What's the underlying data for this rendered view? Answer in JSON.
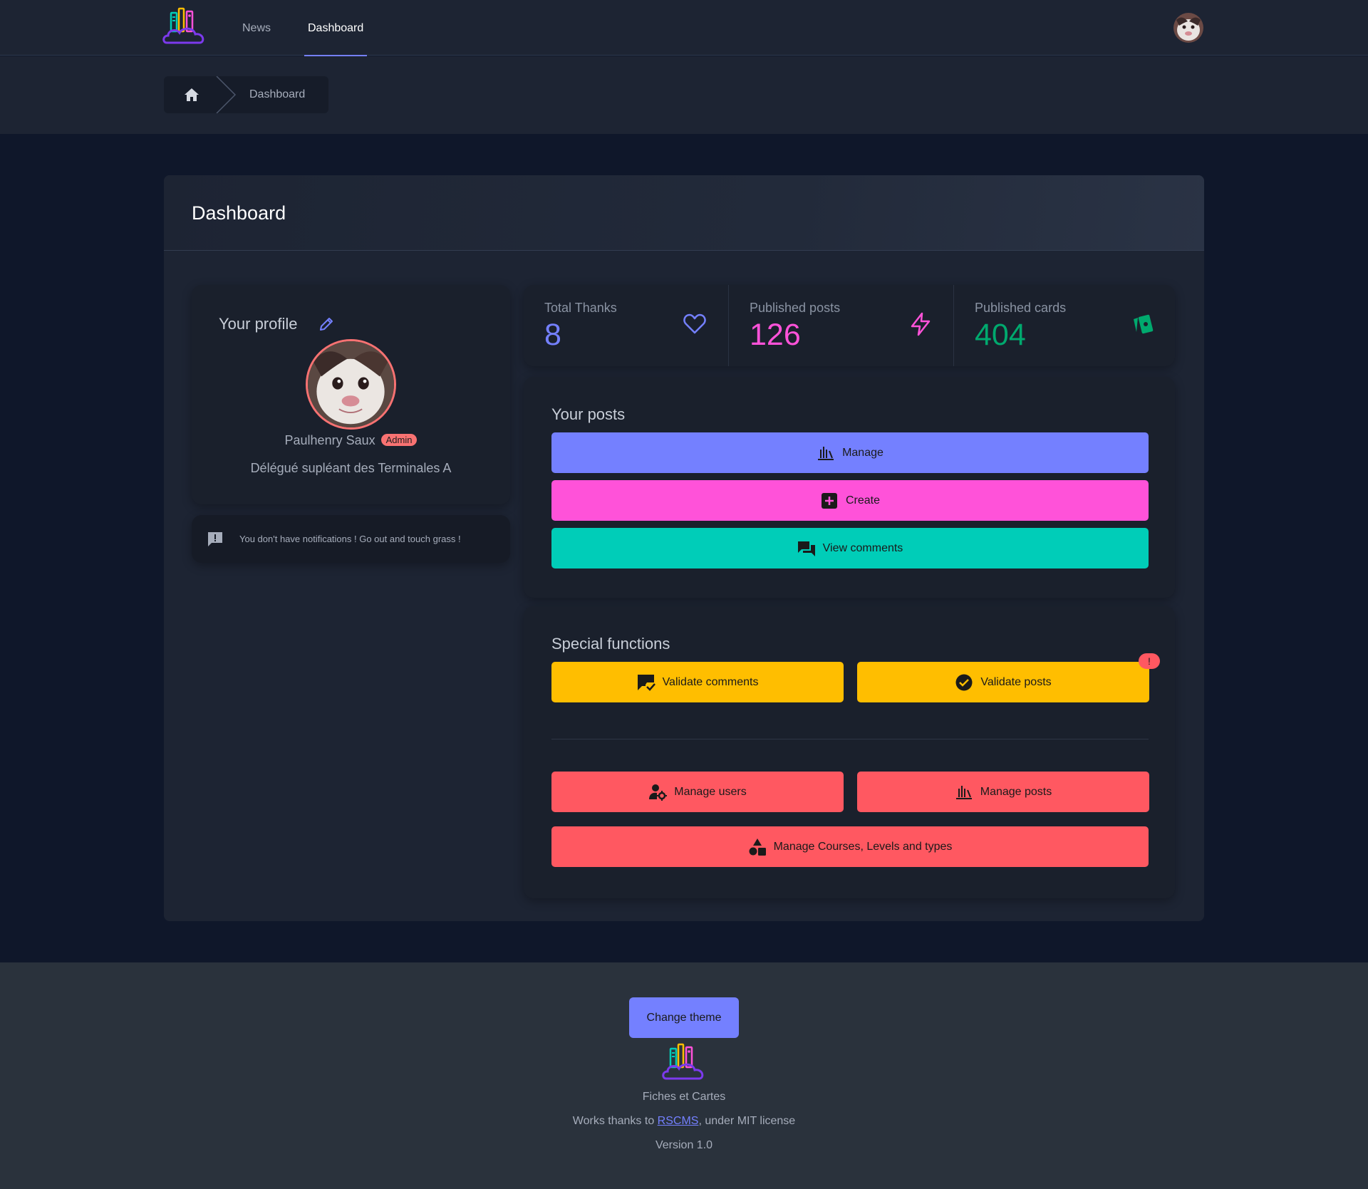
{
  "nav": {
    "links": [
      {
        "label": "News",
        "active": false
      },
      {
        "label": "Dashboard",
        "active": true
      }
    ],
    "logo_icon": "books-cloud-logo",
    "avatar_icon": "cat-avatar"
  },
  "breadcrumb": {
    "home_icon": "home-icon",
    "current": "Dashboard"
  },
  "page": {
    "title": "Dashboard"
  },
  "profile": {
    "heading": "Your profile",
    "edit_icon": "pencil-icon",
    "name": "Paulhenry Saux",
    "badge": "Admin",
    "role": "Délégué supléant des Terminales A"
  },
  "notification": {
    "icon": "announcement-icon",
    "text": "You don't have notifications ! Go out and touch grass !"
  },
  "stats": [
    {
      "title": "Total Thanks",
      "value": "8",
      "icon": "heart-icon",
      "color": "#7480ff"
    },
    {
      "title": "Published posts",
      "value": "126",
      "icon": "lightning-icon",
      "color": "#ff52d9"
    },
    {
      "title": "Published cards",
      "value": "404",
      "icon": "cards-icon",
      "color": "#00a96e"
    }
  ],
  "posts": {
    "title": "Your posts",
    "buttons": {
      "manage": "Manage",
      "create": "Create",
      "view_comments": "View comments"
    }
  },
  "special": {
    "title": "Special functions",
    "validate_comments": "Validate comments",
    "validate_posts": "Validate posts",
    "validate_posts_indicator": "!",
    "manage_users": "Manage users",
    "manage_posts": "Manage posts",
    "manage_courses": "Manage Courses, Levels and types"
  },
  "footer": {
    "theme_button": "Change theme",
    "site_name": "Fiches et Cartes",
    "credits_prefix": "Works thanks to ",
    "credits_link": "RSCMS",
    "credits_suffix": ", under MIT license",
    "version": "Version 1.0"
  },
  "colors": {
    "primary": "#7480ff",
    "secondary": "#ff52d9",
    "accent": "#00cdb8",
    "warning": "#ffbe00",
    "error": "#ff5861",
    "success": "#00a96e"
  }
}
